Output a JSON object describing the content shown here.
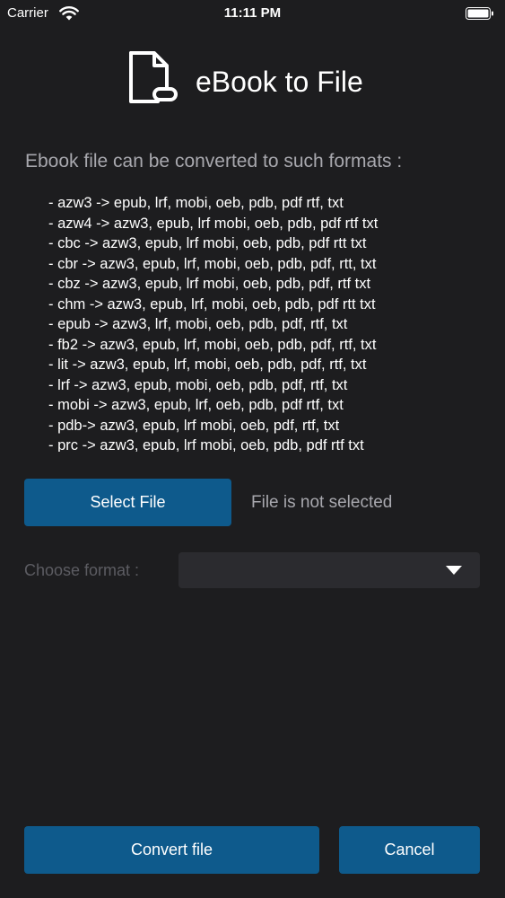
{
  "status_bar": {
    "carrier": "Carrier",
    "time": "11:11 PM",
    "wifi_icon": "wifi-icon",
    "battery_icon": "battery-icon"
  },
  "header": {
    "logo_icon": "document-icon",
    "title": "eBook to File"
  },
  "intro": "Ebook file can be converted to such formats :",
  "formats": [
    "- azw3 -> epub, lrf, mobi, oeb, pdb, pdf rtf, txt",
    "- azw4 -> azw3, epub, lrf mobi, oeb, pdb, pdf rtf txt",
    "- cbc -> azw3, epub, lrf mobi, oeb, pdb, pdf rtt txt",
    "- cbr -> azw3, epub, lrf, mobi, oeb, pdb, pdf, rtt, txt",
    "- cbz -> azw3, epub, lrf mobi, oeb, pdb, pdf, rtf txt",
    "- chm -> azw3, epub, lrf, mobi, oeb, pdb, pdf rtt txt",
    "- epub -> azw3, lrf, mobi, oeb, pdb, pdf, rtf, txt",
    "- fb2 -> azw3, epub, lrf, mobi, oeb, pdb, pdf, rtf, txt",
    "- lit -> azw3, epub, lrf, mobi, oeb, pdb, pdf, rtf, txt",
    "- lrf -> azw3, epub, mobi, oeb, pdb, pdf, rtf, txt",
    "- mobi -> azw3, epub, lrf, oeb, pdb, pdf rtf, txt",
    "- pdb-> azw3, epub, lrf mobi, oeb, pdf, rtf, txt",
    "- prc -> azw3, epub, lrf mobi, oeb, pdb, pdf rtf txt"
  ],
  "file": {
    "select_label": "Select File",
    "status": "File is not selected"
  },
  "format_picker": {
    "label": "Choose format :",
    "selected": "",
    "icon": "chevron-down-icon"
  },
  "actions": {
    "convert_label": "Convert file",
    "cancel_label": "Cancel"
  },
  "colors": {
    "background": "#1d1d1f",
    "accent": "#0e5a8c",
    "muted_text": "#a8a8ae",
    "disabled_text": "#5c5c62",
    "field_bg": "#2b2b2f"
  }
}
